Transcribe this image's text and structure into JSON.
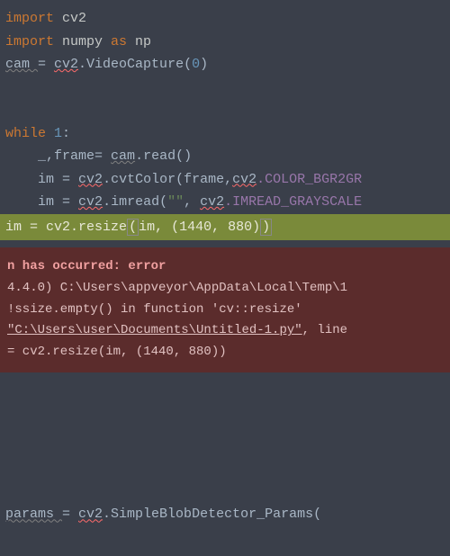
{
  "code": {
    "l1": {
      "kw": "import",
      "mod": " cv2"
    },
    "l2": {
      "kw": "import",
      "mod": " numpy ",
      "as": "as",
      "alias": " np"
    },
    "l3": {
      "var": "cam ",
      "eq": "= ",
      "cv": "cv2",
      "call": ".VideoCapture(",
      "arg": "0",
      "close": ")"
    },
    "l4": {
      "kw": "while ",
      "cond": "1",
      "colon": ":"
    },
    "l5": {
      "indent": "    ",
      "lhs": "_,frame",
      "eq": "= ",
      "obj": "cam",
      "call": ".read()"
    },
    "l6": {
      "indent": "    ",
      "lhs": "im ",
      "eq": "= ",
      "cv": "cv2",
      "call": ".cvtColor(frame,",
      "cv2b": "cv2",
      "tail": ".COLOR_BGR2GR"
    },
    "l7": {
      "indent": "    ",
      "lhs": "im ",
      "eq": "= ",
      "cv": "cv2",
      "call": ".imread(",
      "str": "\"\"",
      "comma": ", ",
      "cv2b": "cv2",
      "tail": ".IMREAD_GRAYSCALE"
    },
    "l8": {
      "indent": "    ",
      "lhs": "im ",
      "eq": "= ",
      "cv": "cv2",
      "call": ".resize",
      "open": "(",
      "args": "im, (",
      "n1": "1440",
      "comma": ", ",
      "n2": "880",
      "close": ")",
      "close2": ")"
    }
  },
  "error": {
    "header": "n has occurred: error",
    "l1": "4.4.0) C:\\Users\\appveyor\\AppData\\Local\\Temp\\1",
    "l2": " !ssize.empty() in function 'cv::resize'",
    "l3a": "\"C:\\Users\\user\\Documents\\Untitled-1.py\"",
    "l3b": ", line",
    "l4": "= cv2.resize(im, (1440, 880))"
  },
  "bottom": {
    "lhs": "params ",
    "eq": "= ",
    "cv": "cv2",
    "tail": ".SimpleBlobDetector_Params("
  }
}
